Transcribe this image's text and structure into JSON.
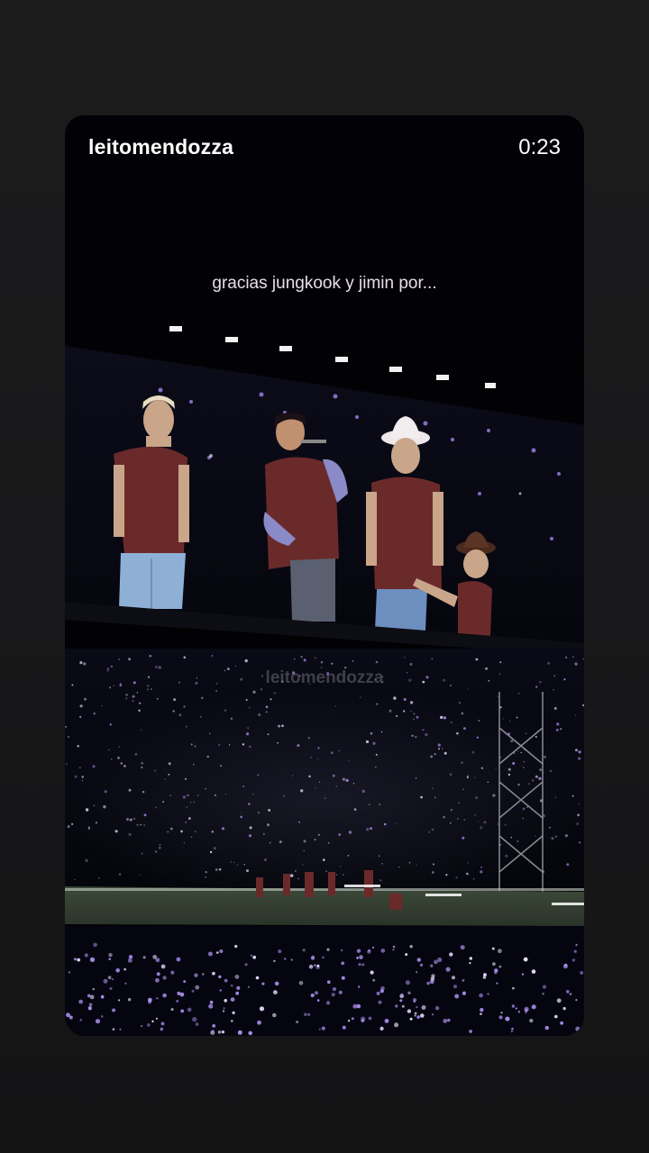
{
  "story": {
    "username": "leitomendozza",
    "duration": "0:23",
    "caption": "gracias jungkook y jimin por...",
    "watermark": "leitomendozza"
  },
  "colors": {
    "page_background": "#1a1a1b",
    "card_background": "#020205",
    "lightstick_purple": "#a98be8",
    "shirt_maroon": "#6b2a2a"
  }
}
